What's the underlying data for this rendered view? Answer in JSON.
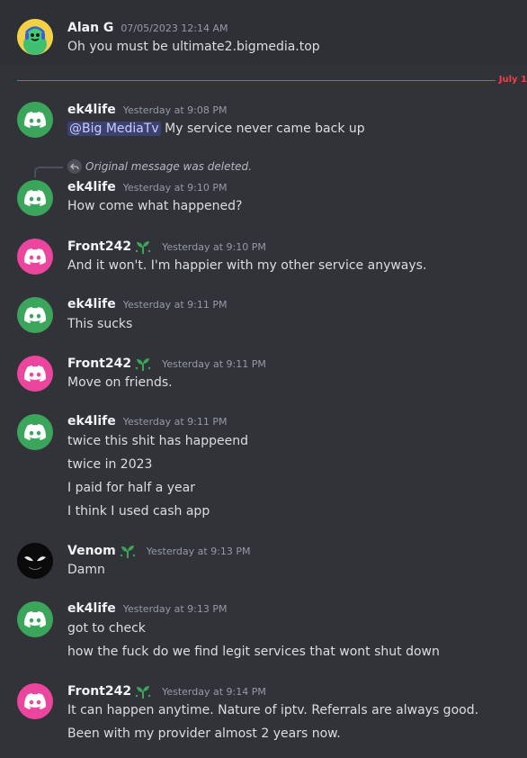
{
  "separator": {
    "label": "July 1"
  },
  "reply": {
    "text": "Original message was deleted."
  },
  "messages": [
    {
      "author": "Alan G",
      "time": "07/05/2023 12:14 AM",
      "avatar": "cartoon-avatar",
      "lines": [
        "Oh you must be ultimate2.bigmedia.top"
      ]
    },
    {
      "author": "ek4life",
      "time": "Yesterday at 9:08 PM",
      "avatar": "discord-green",
      "mention": "@Big MediaTv",
      "lines": [
        " My service never came back up"
      ]
    },
    {
      "author": "ek4life",
      "time": "Yesterday at 9:10 PM",
      "avatar": "discord-green",
      "lines": [
        "How come what happened?"
      ]
    },
    {
      "author": "Front242",
      "time": "Yesterday at 9:10 PM",
      "avatar": "discord-pink",
      "badge": "sprout-icon",
      "lines": [
        "And it won't. I'm happier with my other service anyways."
      ]
    },
    {
      "author": "ek4life",
      "time": "Yesterday at 9:11 PM",
      "avatar": "discord-green",
      "lines": [
        "This sucks"
      ]
    },
    {
      "author": "Front242",
      "time": "Yesterday at 9:11 PM",
      "avatar": "discord-pink",
      "badge": "sprout-icon",
      "lines": [
        "Move on friends."
      ]
    },
    {
      "author": "ek4life",
      "time": "Yesterday at 9:11 PM",
      "avatar": "discord-green",
      "lines": [
        "twice this shit has happeend",
        "twice in 2023",
        "I paid for half a year",
        "I think I used cash app"
      ]
    },
    {
      "author": "Venom",
      "time": "Yesterday at 9:13 PM",
      "avatar": "venom-avatar",
      "badge": "sprout-icon",
      "lines": [
        "Damn"
      ]
    },
    {
      "author": "ek4life",
      "time": "Yesterday at 9:13 PM",
      "avatar": "discord-green",
      "lines": [
        "got to check",
        "how the fuck do we find legit services that wont shut down"
      ]
    },
    {
      "author": "Front242",
      "time": "Yesterday at 9:14 PM",
      "avatar": "discord-pink",
      "badge": "sprout-icon",
      "lines": [
        "It can happen anytime. Nature of iptv. Referrals are always good.",
        "Been with my provider almost 2 years now."
      ]
    }
  ],
  "colors": {
    "background": "#313338",
    "new_divider": "#f23f43",
    "mention_bg": "#3c4270",
    "discord_green": "#3ba55c",
    "discord_pink": "#eb459e"
  }
}
